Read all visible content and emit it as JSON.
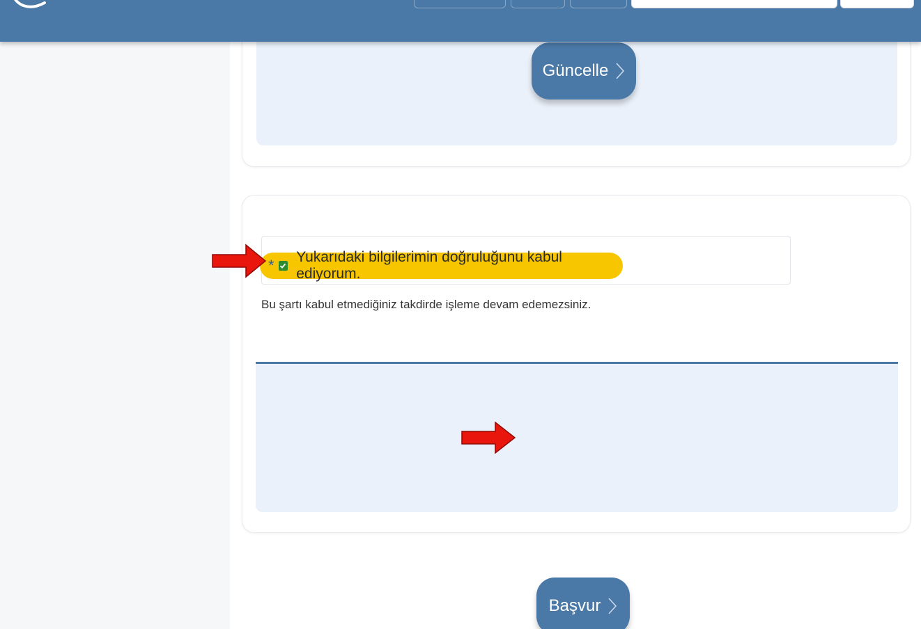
{
  "colors": {
    "header": "#4a78a7",
    "button": "#4a78a7",
    "panel": "#eaf1fa",
    "highlight": "#f7c600",
    "checkbox": "#2e8b2e",
    "arrow": "#e8160c"
  },
  "top_section": {
    "update_button_label": "Güncelle",
    "update_button_icon": "chevron-right-icon"
  },
  "consent": {
    "required_mark": "*",
    "checked": true,
    "label": "Yukarıdaki bilgilerimin doğruluğunu kabul ediyorum.",
    "hint": "Bu şartı kabul etmediğiniz takdirde işleme devam edemezsiniz."
  },
  "submit": {
    "button_label": "Başvur",
    "button_icon": "chevron-right-icon"
  }
}
